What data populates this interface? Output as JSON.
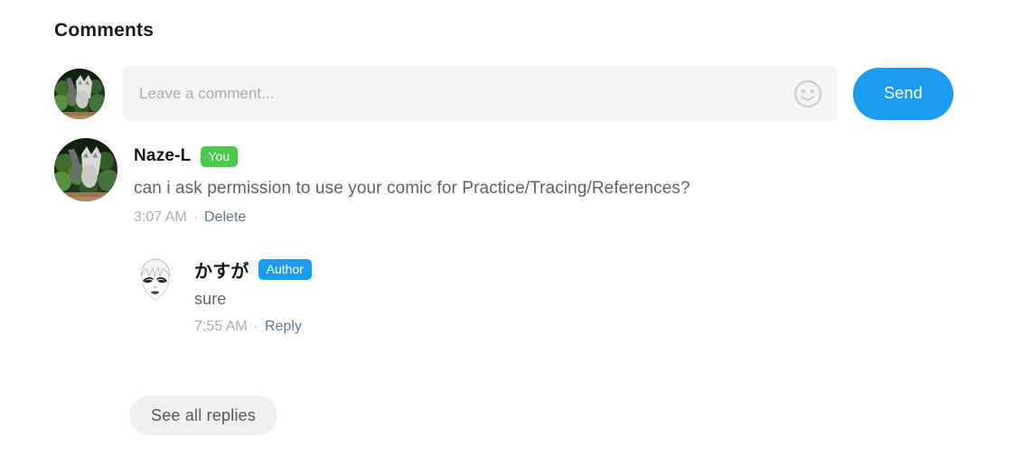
{
  "section": {
    "title": "Comments"
  },
  "composer": {
    "avatar_name": "cat-photo-avatar",
    "placeholder": "Leave a comment...",
    "value": "",
    "emoji_icon": "smiley-face-icon",
    "send_label": "Send"
  },
  "comments": [
    {
      "avatar_name": "cat-photo-avatar",
      "username": "Naze-L",
      "badge": "You",
      "badge_color": "#4ac94a",
      "text": "can i ask permission to use your comic for Practice/Tracing/References?",
      "time": "3:07 AM",
      "separator": "·",
      "action": "Delete",
      "replies": [
        {
          "avatar_name": "manga-face-avatar",
          "username": "かすが",
          "badge": "Author",
          "badge_color": "#1c9cf0",
          "text": "sure",
          "time": "7:55 AM",
          "separator": "·",
          "action": "Reply"
        }
      ]
    }
  ],
  "see_all_replies": {
    "label": "See all replies"
  },
  "colors": {
    "accent_blue": "#1c9cf0",
    "badge_green": "#4ac94a",
    "input_bg": "#f4f4f4",
    "pill_bg": "#efefef",
    "link": "#61798d",
    "muted": "#a8b0b6",
    "body_text": "#5f6368"
  }
}
